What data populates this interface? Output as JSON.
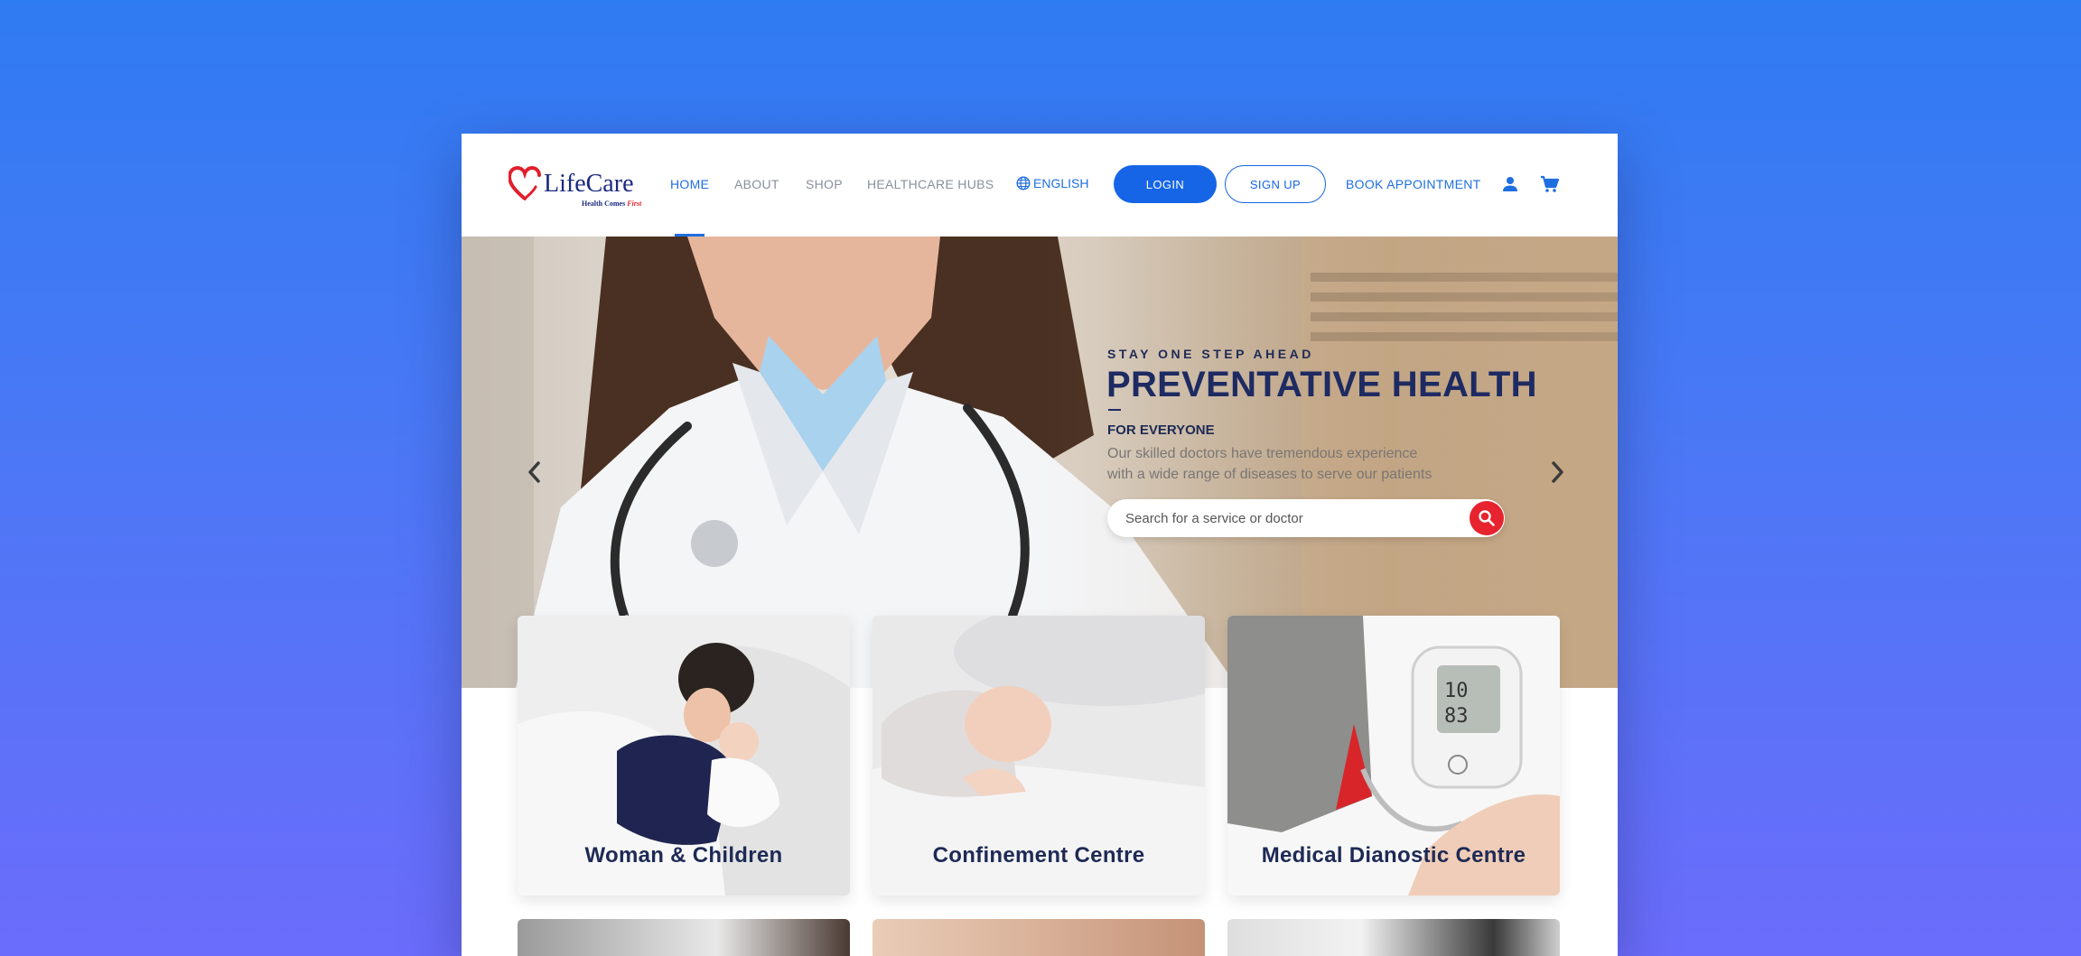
{
  "brand": {
    "name": "LifeCare",
    "tagline_main": "Health Comes",
    "tagline_accent": "First",
    "accent_color": "#e0202b",
    "primary_color": "#1565e6"
  },
  "nav": {
    "items": [
      {
        "label": "HOME",
        "active": true
      },
      {
        "label": "ABOUT",
        "active": false
      },
      {
        "label": "SHOP",
        "active": false
      },
      {
        "label": "HEALTHCARE HUBS",
        "active": false
      }
    ],
    "language": "ENGLISH",
    "login_label": "LOGIN",
    "signup_label": "SIGN UP",
    "book_label": "BOOK APPOINTMENT",
    "account_icon": "person-icon",
    "cart_icon": "cart-icon"
  },
  "hero": {
    "eyebrow": "STAY ONE STEP AHEAD",
    "headline": "PREVENTATIVE HEALTH",
    "subheading": "FOR EVERYONE",
    "description_line1": "Our skilled doctors have tremendous experience",
    "description_line2": "with a wide range of diseases to serve our patients",
    "search_placeholder": "Search for a service or doctor",
    "search_button_color": "#e6232e"
  },
  "cards": [
    {
      "label": "Woman & Children"
    },
    {
      "label": "Confinement Centre"
    },
    {
      "label": "Medical Dianostic Centre"
    }
  ]
}
